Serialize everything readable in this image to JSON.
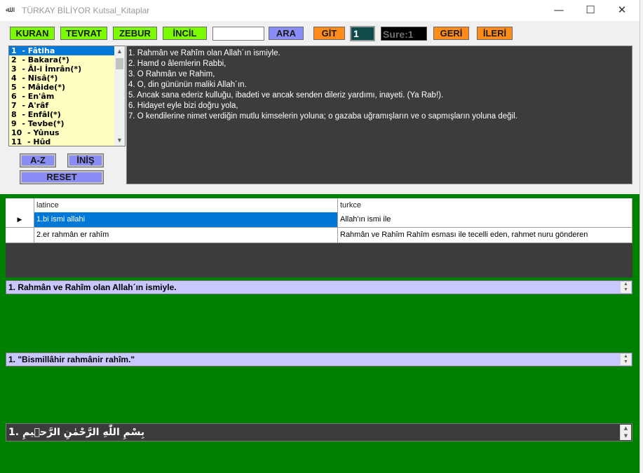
{
  "window": {
    "icon_text": "ﷲ",
    "title": "TÜRKAY BİLİYOR Kutsal_Kitaplar",
    "minimize": "—",
    "maximize": "☐",
    "close": "✕"
  },
  "toolbar": {
    "kuran": "KURAN",
    "tevrat": "TEVRAT",
    "zebur": "ZEBUR",
    "incil": "İNCİL",
    "search_value": "",
    "ara": "ARA",
    "git": "GİT",
    "number_value": "1",
    "sure_label": "Sure:1",
    "geri": "GERİ",
    "ileri": "İLERİ"
  },
  "surah_list": {
    "items": [
      "1  - Fâtiha",
      "2  - Bakara(*)",
      "3  - Âl-i İmrân(*)",
      "4  - Nisâ(*)",
      "5  - Mâide(*)",
      "6  - En'âm",
      "7  - A'râf",
      "8  - Enfâl(*)",
      "9  - Tevbe(*)",
      "10  - Yûnus",
      "11  - Hûd"
    ],
    "selected_index": 0
  },
  "sort_buttons": {
    "az": "A-Z",
    "inis": "İNİŞ",
    "reset": "RESET"
  },
  "verses": [
    "1. Rahmân ve Rahîm olan Allah´ın ismiyle.",
    "2. Hamd o âlemlerin Rabbi,",
    "3. O Rahmân ve Rahim,",
    "4. O, din gününün maliki Allah´ın.",
    "5. Ancak sana ederiz kulluğu, ibadeti ve ancak senden dileriz yardımı, inayeti. (Ya Rab!).",
    "6. Hidayet eyle bizi doğru yola,",
    "7. O kendilerine nimet verdiğin mutlu kimselerin yoluna; o gazaba uğramışların ve o sapmışların yoluna değil."
  ],
  "grid": {
    "columns": [
      "latince",
      "turkce"
    ],
    "rows": [
      {
        "marker": "▶",
        "latince": "1.bi ismi allahi",
        "turkce": "Allah'ın ismi ile"
      },
      {
        "marker": "",
        "latince": "2.er rahmân er rahîm",
        "turkce": "Rahmân ve Rahîm Rahîm esması ile tecelli eden, rahmet nuru gönderen"
      }
    ]
  },
  "meal_box": "1. Rahmân ve Rahîm olan Allah´ın ismiyle.",
  "okunus_box": "1. \"Bismillâhir rahmânir rahîm.\"",
  "arabic_box": "بِسْمِ اللّٰهِ الرَّحْمٰنِ الرَّح۪يمِ .1",
  "colors": {
    "green_bg": "#008000",
    "button_green": "#7cfc00",
    "button_blue": "#8a8df5",
    "button_orange": "#ff8c1a",
    "list_bg": "#ffffc2",
    "dark_panel": "#3c3c3c",
    "selection": "#0078d7"
  }
}
